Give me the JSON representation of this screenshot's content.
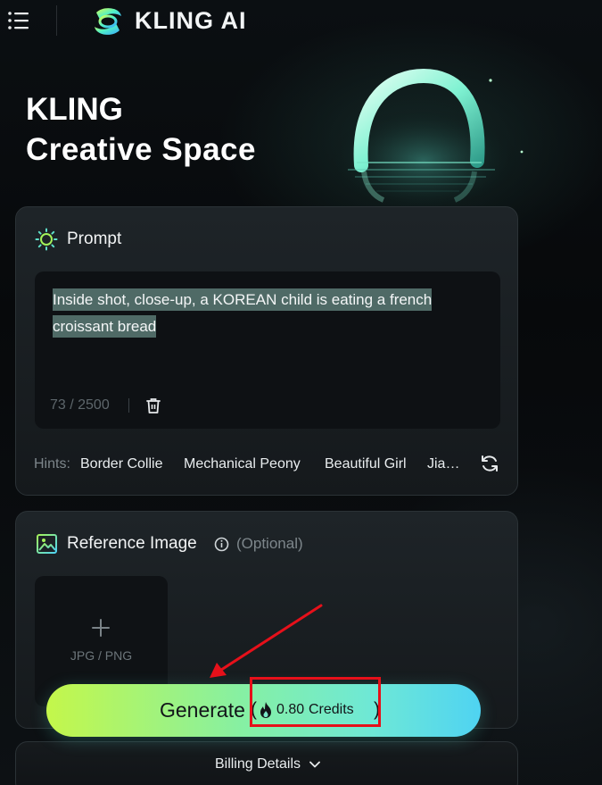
{
  "header": {
    "logo_text": "KLING AI"
  },
  "hero": {
    "line1": "KLING",
    "line2": "Creative Space"
  },
  "prompt_section": {
    "title": "Prompt",
    "text_line1": "Inside shot, close-up, a KOREAN child is eating  a french",
    "text_line2": "croissant bread",
    "char_count": "73 / 2500",
    "hints_label": "Hints:",
    "hints": [
      "Border Collie",
      "Mechanical Peony",
      "Beautiful Girl",
      "Jia…"
    ]
  },
  "reference_section": {
    "title": "Reference Image",
    "optional": "(Optional)",
    "upload_hint": "JPG / PNG"
  },
  "generate": {
    "label": "Generate",
    "paren_open": "(",
    "credits_value": "0.80",
    "credits_label": "Credits",
    "paren_close": ")"
  },
  "billing": {
    "label": "Billing Details"
  },
  "icons": {
    "menu": "menu-icon",
    "logo": "kling-logo-icon",
    "prompt": "sun-icon",
    "trash": "trash-icon",
    "refresh": "refresh-icon",
    "reference": "image-icon",
    "info": "info-icon",
    "plus": "plus-icon",
    "credits": "fire-icon",
    "billing": "chevron-down-icon"
  },
  "colors": {
    "accent_green": "#c4f74a",
    "accent_cyan": "#4fd3f2",
    "annotation_red": "#e6101a",
    "highlight": "#4f6a66"
  }
}
